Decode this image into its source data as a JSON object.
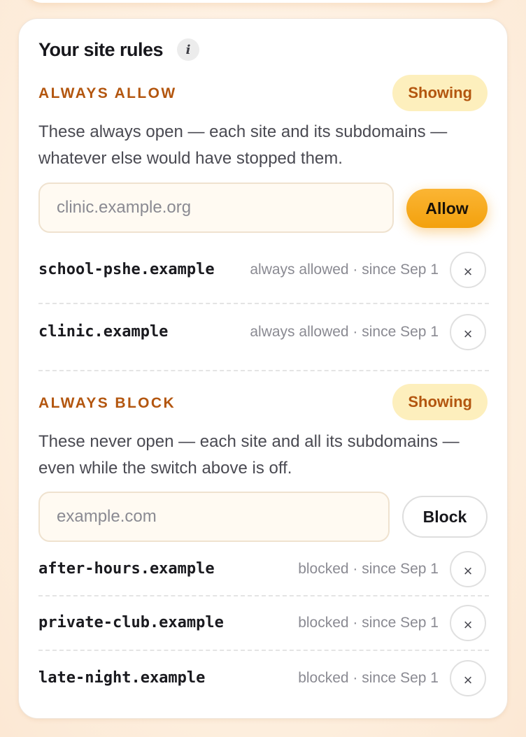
{
  "panel": {
    "title": "Your site rules",
    "info_glyph": "i"
  },
  "allow_section": {
    "label": "ALWAYS ALLOW",
    "toggle_label": "Showing",
    "description": "These always open — each site and its subdomains — whatever else would have stopped them.",
    "input_placeholder": "clinic.example.org",
    "input_value": "",
    "button_label": "Allow",
    "items": [
      {
        "domain": "school-pshe.example",
        "meta": "always allowed · since Sep 1"
      },
      {
        "domain": "clinic.example",
        "meta": "always allowed · since Sep 1"
      }
    ]
  },
  "block_section": {
    "label": "ALWAYS BLOCK",
    "toggle_label": "Showing",
    "description": "These never open — each site and all its subdomains — even while the switch above is off.",
    "input_placeholder": "example.com",
    "input_value": "",
    "button_label": "Block",
    "items": [
      {
        "domain": "after-hours.example",
        "meta": "blocked · since Sep 1"
      },
      {
        "domain": "private-club.example",
        "meta": "blocked · since Sep 1"
      },
      {
        "domain": "late-night.example",
        "meta": "blocked · since Sep 1"
      }
    ]
  },
  "icons": {
    "remove": "×",
    "info": "info-icon",
    "remove_name": "close-icon"
  },
  "colors": {
    "accent": "#b3560f",
    "allow_button": "#f3a10d",
    "pill_background": "#fdefbd"
  }
}
